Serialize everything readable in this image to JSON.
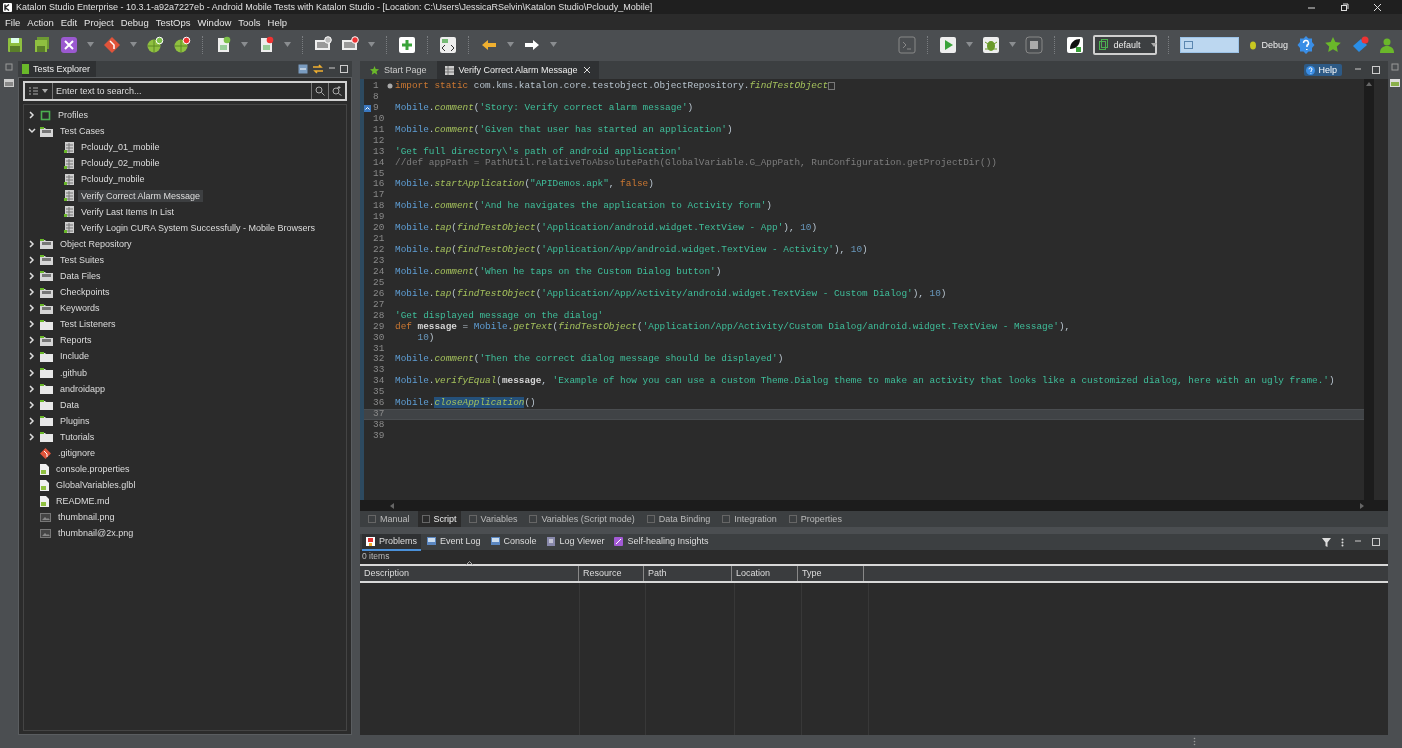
{
  "window": {
    "title": "Katalon Studio Enterprise - 10.3.1-a92a7227eb - Android Mobile Tests with Katalon Studio - [Location: C:\\Users\\JessicaRSelvin\\Katalon Studio\\Pcloudy_Mobile]"
  },
  "menu": [
    "File",
    "Action",
    "Edit",
    "Project",
    "Debug",
    "TestOps",
    "Window",
    "Tools",
    "Help"
  ],
  "toolbar": {
    "profile": "default",
    "debug_label": "Debug"
  },
  "explorer": {
    "title": "Tests Explorer",
    "search": {
      "placeholder": "Enter text to search..."
    },
    "tree": [
      {
        "label": "Profiles",
        "kind": "profiles",
        "expanded": false,
        "selected": false
      },
      {
        "label": "Test Cases",
        "kind": "special-folder",
        "expanded": true,
        "selected": false,
        "children": [
          {
            "label": "Pcloudy_01_mobile",
            "kind": "test-case",
            "selected": false
          },
          {
            "label": "Pcloudy_02_mobile",
            "kind": "test-case",
            "selected": false
          },
          {
            "label": "Pcloudy_mobile",
            "kind": "test-case",
            "selected": false
          },
          {
            "label": "Verify Correct Alarm Message",
            "kind": "test-case",
            "selected": true
          },
          {
            "label": "Verify Last Items In List",
            "kind": "test-case",
            "selected": false
          },
          {
            "label": "Verify Login CURA System Successfully - Mobile Browsers",
            "kind": "test-case",
            "selected": false
          }
        ]
      },
      {
        "label": "Object Repository",
        "kind": "special-folder",
        "expanded": false,
        "selected": false
      },
      {
        "label": "Test Suites",
        "kind": "special-folder",
        "expanded": false,
        "selected": false
      },
      {
        "label": "Data Files",
        "kind": "special-folder",
        "expanded": false,
        "selected": false
      },
      {
        "label": "Checkpoints",
        "kind": "special-folder",
        "expanded": false,
        "selected": false
      },
      {
        "label": "Keywords",
        "kind": "special-folder",
        "expanded": false,
        "selected": false
      },
      {
        "label": "Test Listeners",
        "kind": "folder",
        "expanded": false,
        "selected": false
      },
      {
        "label": "Reports",
        "kind": "special-folder",
        "expanded": false,
        "selected": false
      },
      {
        "label": "Include",
        "kind": "folder",
        "expanded": false,
        "selected": false
      },
      {
        "label": ".github",
        "kind": "folder",
        "expanded": false,
        "selected": false
      },
      {
        "label": "androidapp",
        "kind": "folder",
        "expanded": false,
        "selected": false
      },
      {
        "label": "Data",
        "kind": "folder",
        "expanded": false,
        "selected": false
      },
      {
        "label": "Plugins",
        "kind": "folder",
        "expanded": false,
        "selected": false
      },
      {
        "label": "Tutorials",
        "kind": "folder",
        "expanded": false,
        "selected": false
      },
      {
        "label": ".gitignore",
        "kind": "git-file",
        "selected": false
      },
      {
        "label": "console.properties",
        "kind": "file",
        "selected": false
      },
      {
        "label": "GlobalVariables.glbl",
        "kind": "file",
        "selected": false
      },
      {
        "label": "README.md",
        "kind": "file",
        "selected": false
      },
      {
        "label": "thumbnail.png",
        "kind": "image-file",
        "selected": false
      },
      {
        "label": "thumbnail@2x.png",
        "kind": "image-file",
        "selected": false
      }
    ]
  },
  "editor": {
    "tabs": [
      {
        "label": "Start Page",
        "selected": false
      },
      {
        "label": "Verify Correct Alarm Message",
        "selected": true
      }
    ],
    "help": "Help",
    "lines": [
      {
        "number": "1",
        "folded": true,
        "bookmark": false,
        "current": false,
        "tokens": [
          {
            "kind": "kw",
            "text": "import static "
          },
          {
            "kind": "plain",
            "text": "com.kms.katalon.core.testobject.ObjectRepository."
          },
          {
            "kind": "method",
            "text": "findTestObject"
          }
        ]
      },
      {
        "number": "8",
        "folded": false,
        "bookmark": false,
        "current": false
      },
      {
        "number": "9",
        "folded": false,
        "bookmark": true,
        "current": false,
        "tokens": [
          {
            "kind": "cls",
            "text": "Mobile"
          },
          {
            "kind": "plain",
            "text": "."
          },
          {
            "kind": "method",
            "text": "comment"
          },
          {
            "kind": "plain",
            "text": "("
          },
          {
            "kind": "str",
            "text": "'Story: Verify correct alarm message'"
          },
          {
            "kind": "plain",
            "text": ")"
          }
        ]
      },
      {
        "number": "10",
        "folded": false,
        "bookmark": false,
        "current": false
      },
      {
        "number": "11",
        "folded": false,
        "bookmark": false,
        "current": false,
        "tokens": [
          {
            "kind": "cls",
            "text": "Mobile"
          },
          {
            "kind": "plain",
            "text": "."
          },
          {
            "kind": "method",
            "text": "comment"
          },
          {
            "kind": "plain",
            "text": "("
          },
          {
            "kind": "str",
            "text": "'Given that user has started an application'"
          },
          {
            "kind": "plain",
            "text": ")"
          }
        ]
      },
      {
        "number": "12",
        "folded": false,
        "bookmark": false,
        "current": false
      },
      {
        "number": "13",
        "folded": false,
        "bookmark": false,
        "current": false,
        "tokens": [
          {
            "kind": "str",
            "text": "'Get full directory\\'s path of android application'"
          }
        ]
      },
      {
        "number": "14",
        "folded": false,
        "bookmark": false,
        "current": false,
        "tokens": [
          {
            "kind": "comment",
            "text": "//def appPath = PathUtil.relativeToAbsolutePath(GlobalVariable.G_AppPath, RunConfiguration.getProjectDir())"
          }
        ]
      },
      {
        "number": "15",
        "folded": false,
        "bookmark": false,
        "current": false
      },
      {
        "number": "16",
        "folded": false,
        "bookmark": false,
        "current": false,
        "tokens": [
          {
            "kind": "cls",
            "text": "Mobile"
          },
          {
            "kind": "plain",
            "text": "."
          },
          {
            "kind": "method",
            "text": "startApplication"
          },
          {
            "kind": "plain",
            "text": "("
          },
          {
            "kind": "str",
            "text": "\"APIDemos.apk\""
          },
          {
            "kind": "plain",
            "text": ", "
          },
          {
            "kind": "kw",
            "text": "false"
          },
          {
            "kind": "plain",
            "text": ")"
          }
        ]
      },
      {
        "number": "17",
        "folded": false,
        "bookmark": false,
        "current": false
      },
      {
        "number": "18",
        "folded": false,
        "bookmark": false,
        "current": false,
        "tokens": [
          {
            "kind": "cls",
            "text": "Mobile"
          },
          {
            "kind": "plain",
            "text": "."
          },
          {
            "kind": "method",
            "text": "comment"
          },
          {
            "kind": "plain",
            "text": "("
          },
          {
            "kind": "str",
            "text": "'And he navigates the application to Activity form'"
          },
          {
            "kind": "plain",
            "text": ")"
          }
        ]
      },
      {
        "number": "19",
        "folded": false,
        "bookmark": false,
        "current": false
      },
      {
        "number": "20",
        "folded": false,
        "bookmark": false,
        "current": false,
        "tokens": [
          {
            "kind": "cls",
            "text": "Mobile"
          },
          {
            "kind": "plain",
            "text": "."
          },
          {
            "kind": "method",
            "text": "tap"
          },
          {
            "kind": "plain",
            "text": "("
          },
          {
            "kind": "method",
            "text": "findTestObject"
          },
          {
            "kind": "plain",
            "text": "("
          },
          {
            "kind": "str",
            "text": "'Application/android.widget.TextView - App'"
          },
          {
            "kind": "plain",
            "text": "), "
          },
          {
            "kind": "num",
            "text": "10"
          },
          {
            "kind": "plain",
            "text": ")"
          }
        ]
      },
      {
        "number": "21",
        "folded": false,
        "bookmark": false,
        "current": false
      },
      {
        "number": "22",
        "folded": false,
        "bookmark": false,
        "current": false,
        "tokens": [
          {
            "kind": "cls",
            "text": "Mobile"
          },
          {
            "kind": "plain",
            "text": "."
          },
          {
            "kind": "method",
            "text": "tap"
          },
          {
            "kind": "plain",
            "text": "("
          },
          {
            "kind": "method",
            "text": "findTestObject"
          },
          {
            "kind": "plain",
            "text": "("
          },
          {
            "kind": "str",
            "text": "'Application/App/android.widget.TextView - Activity'"
          },
          {
            "kind": "plain",
            "text": "), "
          },
          {
            "kind": "num",
            "text": "10"
          },
          {
            "kind": "plain",
            "text": ")"
          }
        ]
      },
      {
        "number": "23",
        "folded": false,
        "bookmark": false,
        "current": false
      },
      {
        "number": "24",
        "folded": false,
        "bookmark": false,
        "current": false,
        "tokens": [
          {
            "kind": "cls",
            "text": "Mobile"
          },
          {
            "kind": "plain",
            "text": "."
          },
          {
            "kind": "method",
            "text": "comment"
          },
          {
            "kind": "plain",
            "text": "("
          },
          {
            "kind": "str",
            "text": "'When he taps on the Custom Dialog button'"
          },
          {
            "kind": "plain",
            "text": ")"
          }
        ]
      },
      {
        "number": "25",
        "folded": false,
        "bookmark": false,
        "current": false
      },
      {
        "number": "26",
        "folded": false,
        "bookmark": false,
        "current": false,
        "tokens": [
          {
            "kind": "cls",
            "text": "Mobile"
          },
          {
            "kind": "plain",
            "text": "."
          },
          {
            "kind": "method",
            "text": "tap"
          },
          {
            "kind": "plain",
            "text": "("
          },
          {
            "kind": "method",
            "text": "findTestObject"
          },
          {
            "kind": "plain",
            "text": "("
          },
          {
            "kind": "str",
            "text": "'Application/App/Activity/android.widget.TextView - Custom Dialog'"
          },
          {
            "kind": "plain",
            "text": "), "
          },
          {
            "kind": "num",
            "text": "10"
          },
          {
            "kind": "plain",
            "text": ")"
          }
        ]
      },
      {
        "number": "27",
        "folded": false,
        "bookmark": false,
        "current": false
      },
      {
        "number": "28",
        "folded": false,
        "bookmark": false,
        "current": false,
        "tokens": [
          {
            "kind": "str",
            "text": "'Get displayed message on the dialog'"
          }
        ]
      },
      {
        "number": "29",
        "folded": false,
        "bookmark": false,
        "current": false,
        "tokens": [
          {
            "kind": "kw",
            "text": "def "
          },
          {
            "kind": "var",
            "text": "message"
          },
          {
            "kind": "plain",
            "text": " = "
          },
          {
            "kind": "cls",
            "text": "Mobile"
          },
          {
            "kind": "plain",
            "text": "."
          },
          {
            "kind": "method",
            "text": "getText"
          },
          {
            "kind": "plain",
            "text": "("
          },
          {
            "kind": "method",
            "text": "findTestObject"
          },
          {
            "kind": "plain",
            "text": "("
          },
          {
            "kind": "str",
            "text": "'Application/App/Activity/Custom Dialog/android.widget.TextView - Message'"
          },
          {
            "kind": "plain",
            "text": "),"
          }
        ]
      },
      {
        "number": "30",
        "folded": false,
        "bookmark": false,
        "current": false,
        "tokens": [
          {
            "kind": "num",
            "text": "    10"
          },
          {
            "kind": "plain",
            "text": ")"
          }
        ]
      },
      {
        "number": "31",
        "folded": false,
        "bookmark": false,
        "current": false
      },
      {
        "number": "32",
        "folded": false,
        "bookmark": false,
        "current": false,
        "tokens": [
          {
            "kind": "cls",
            "text": "Mobile"
          },
          {
            "kind": "plain",
            "text": "."
          },
          {
            "kind": "method",
            "text": "comment"
          },
          {
            "kind": "plain",
            "text": "("
          },
          {
            "kind": "str",
            "text": "'Then the correct dialog message should be displayed'"
          },
          {
            "kind": "plain",
            "text": ")"
          }
        ]
      },
      {
        "number": "33",
        "folded": false,
        "bookmark": false,
        "current": false
      },
      {
        "number": "34",
        "folded": false,
        "bookmark": false,
        "current": false,
        "tokens": [
          {
            "kind": "cls",
            "text": "Mobile"
          },
          {
            "kind": "plain",
            "text": "."
          },
          {
            "kind": "method",
            "text": "verifyEqual"
          },
          {
            "kind": "plain",
            "text": "("
          },
          {
            "kind": "var",
            "text": "message"
          },
          {
            "kind": "plain",
            "text": ", "
          },
          {
            "kind": "str",
            "text": "'Example of how you can use a custom Theme.Dialog theme to make an activity that looks like a customized dialog, here with an ugly frame.'"
          },
          {
            "kind": "plain",
            "text": ")"
          }
        ]
      },
      {
        "number": "35",
        "folded": false,
        "bookmark": false,
        "current": false
      },
      {
        "number": "36",
        "folded": false,
        "bookmark": false,
        "current": false,
        "tokens": [
          {
            "kind": "cls",
            "text": "Mobile"
          },
          {
            "kind": "plain",
            "text": "."
          },
          {
            "kind": "method-selected",
            "text": "closeApplication"
          },
          {
            "kind": "plain",
            "text": "()"
          }
        ]
      },
      {
        "number": "37",
        "folded": false,
        "bookmark": false,
        "current": true
      },
      {
        "number": "38",
        "folded": false,
        "bookmark": false,
        "current": false
      },
      {
        "number": "39",
        "folded": false,
        "bookmark": false,
        "current": false
      }
    ],
    "view_tabs": [
      {
        "label": "Manual",
        "selected": false
      },
      {
        "label": "Script",
        "selected": true
      },
      {
        "label": "Variables",
        "selected": false
      },
      {
        "label": "Variables (Script mode)",
        "selected": false
      },
      {
        "label": "Data Binding",
        "selected": false
      },
      {
        "label": "Integration",
        "selected": false
      },
      {
        "label": "Properties",
        "selected": false
      }
    ]
  },
  "problems": {
    "tabs": [
      {
        "label": "Problems",
        "selected": true
      },
      {
        "label": "Event Log",
        "selected": false
      },
      {
        "label": "Console",
        "selected": false
      },
      {
        "label": "Log Viewer",
        "selected": false
      },
      {
        "label": "Self-healing Insights",
        "selected": false
      }
    ],
    "count": "0 items",
    "columns": [
      "Description",
      "Resource",
      "Path",
      "Location",
      "Type"
    ]
  }
}
